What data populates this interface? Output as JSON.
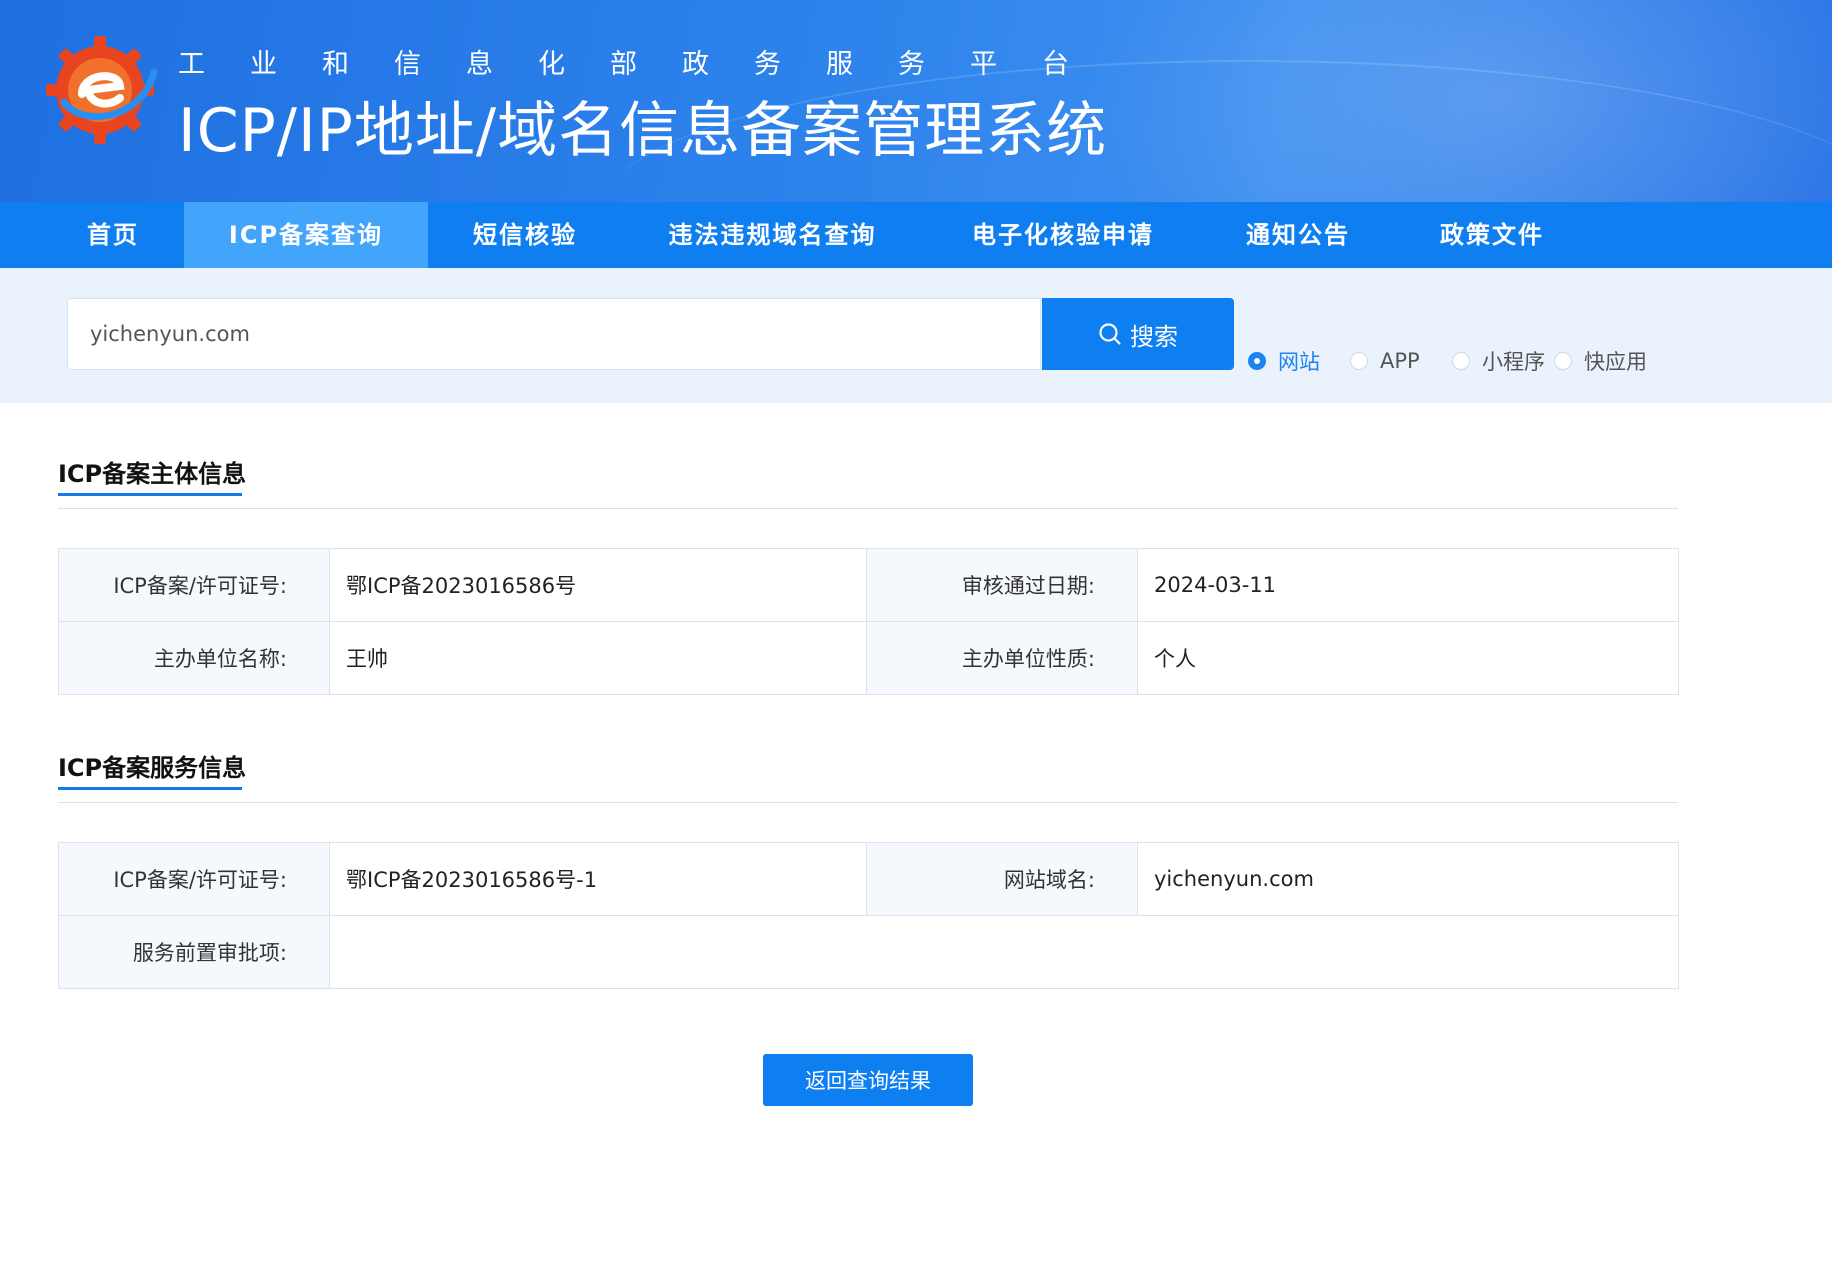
{
  "header": {
    "subtitle": "工业和信息化部政务服务平台",
    "title": "ICP/IP地址/域名信息备案管理系统",
    "logo_icon": "miit-gear-logo"
  },
  "nav": {
    "items": [
      {
        "label": "首页",
        "active": false
      },
      {
        "label": "ICP备案查询",
        "active": true
      },
      {
        "label": "短信核验",
        "active": false
      },
      {
        "label": "违法违规域名查询",
        "active": false
      },
      {
        "label": "电子化核验申请",
        "active": false
      },
      {
        "label": "通知公告",
        "active": false
      },
      {
        "label": "政策文件",
        "active": false
      }
    ]
  },
  "search": {
    "value": "yichenyun.com",
    "button_label": "搜索",
    "options": [
      {
        "label": "网站",
        "checked": true
      },
      {
        "label": "APP",
        "checked": false
      },
      {
        "label": "小程序",
        "checked": false
      },
      {
        "label": "快应用",
        "checked": false
      }
    ]
  },
  "subject_section": {
    "title": "ICP备案主体信息",
    "rows": [
      {
        "label1": "ICP备案/许可证号:",
        "value1": "鄂ICP备2023016586号",
        "label2": "审核通过日期:",
        "value2": "2024-03-11"
      },
      {
        "label1": "主办单位名称:",
        "value1": "王帅",
        "label2": "主办单位性质:",
        "value2": "个人"
      }
    ]
  },
  "service_section": {
    "title": "ICP备案服务信息",
    "row1": {
      "label1": "ICP备案/许可证号:",
      "value1": "鄂ICP备2023016586号-1",
      "label2": "网站域名:",
      "value2": "yichenyun.com"
    },
    "row2": {
      "label": "服务前置审批项:",
      "value": ""
    }
  },
  "back_button": "返回查询结果",
  "colors": {
    "primary": "#0d7ff1",
    "nav_active": "#42a5fb",
    "search_band": "#eaf3fd",
    "label_bg": "#f5f9fe"
  }
}
